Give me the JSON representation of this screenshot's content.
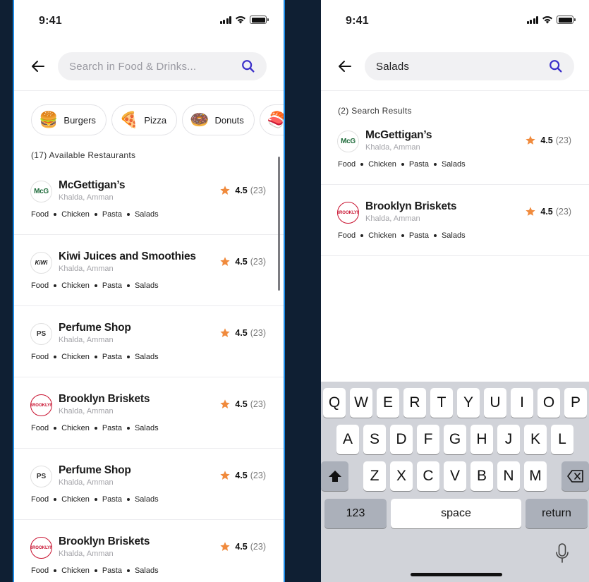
{
  "left_screen": {
    "status": {
      "time": "9:41"
    },
    "search": {
      "placeholder": "Search in Food & Drinks...",
      "value": ""
    },
    "categories": [
      {
        "label": "Burgers",
        "emoji": "🍔",
        "icon": "burger-icon"
      },
      {
        "label": "Pizza",
        "emoji": "🍕",
        "icon": "pizza-icon"
      },
      {
        "label": "Donuts",
        "emoji": "🍩",
        "icon": "donut-icon"
      },
      {
        "label": "",
        "emoji": "🍣",
        "icon": "sushi-icon"
      }
    ],
    "results_label": "(17) Available Restaurants",
    "restaurants": [
      {
        "name": "McGettigan’s",
        "location": "Khalda, Amman",
        "logo": "McG",
        "rating": "4.5",
        "count": "(23)",
        "tags": [
          "Food",
          "Chicken",
          "Pasta",
          "Salads"
        ]
      },
      {
        "name": "Kiwi Juices and Smoothies",
        "location": "Khalda, Amman",
        "logo": "KiWi",
        "rating": "4.5",
        "count": "(23)",
        "tags": [
          "Food",
          "Chicken",
          "Pasta",
          "Salads"
        ]
      },
      {
        "name": "Perfume Shop",
        "location": "Khalda, Amman",
        "logo": "PS",
        "rating": "4.5",
        "count": "(23)",
        "tags": [
          "Food",
          "Chicken",
          "Pasta",
          "Salads"
        ]
      },
      {
        "name": "Brooklyn Briskets",
        "location": "Khalda, Amman",
        "logo": "BROOKLYN",
        "rating": "4.5",
        "count": "(23)",
        "tags": [
          "Food",
          "Chicken",
          "Pasta",
          "Salads"
        ]
      },
      {
        "name": "Perfume Shop",
        "location": "Khalda, Amman",
        "logo": "PS",
        "rating": "4.5",
        "count": "(23)",
        "tags": [
          "Food",
          "Chicken",
          "Pasta",
          "Salads"
        ]
      },
      {
        "name": "Brooklyn Briskets",
        "location": "Khalda, Amman",
        "logo": "BROOKLYN",
        "rating": "4.5",
        "count": "(23)",
        "tags": [
          "Food",
          "Chicken",
          "Pasta",
          "Salads"
        ]
      }
    ]
  },
  "right_screen": {
    "status": {
      "time": "9:41"
    },
    "search": {
      "placeholder": "Search in Food & Drinks...",
      "value": "Salads"
    },
    "results_label": "(2) Search Results",
    "restaurants": [
      {
        "name": "McGettigan’s",
        "location": "Khalda, Amman",
        "logo": "McG",
        "rating": "4.5",
        "count": "(23)",
        "tags": [
          "Food",
          "Chicken",
          "Pasta",
          "Salads"
        ]
      },
      {
        "name": "Brooklyn Briskets",
        "location": "Khalda, Amman",
        "logo": "BROOKLYN",
        "rating": "4.5",
        "count": "(23)",
        "tags": [
          "Food",
          "Chicken",
          "Pasta",
          "Salads"
        ]
      }
    ],
    "keyboard": {
      "row1": [
        "Q",
        "W",
        "E",
        "R",
        "T",
        "Y",
        "U",
        "I",
        "O",
        "P"
      ],
      "row2": [
        "A",
        "S",
        "D",
        "F",
        "G",
        "H",
        "J",
        "K",
        "L"
      ],
      "row3": [
        "Z",
        "X",
        "C",
        "V",
        "B",
        "N",
        "M"
      ],
      "numbers_key": "123",
      "space_key": "space",
      "return_key": "return"
    }
  },
  "colors": {
    "accent": "#3b2fc9",
    "star": "#f08a3c",
    "frame_border": "#1b8ae6",
    "background": "#0f1f33"
  }
}
